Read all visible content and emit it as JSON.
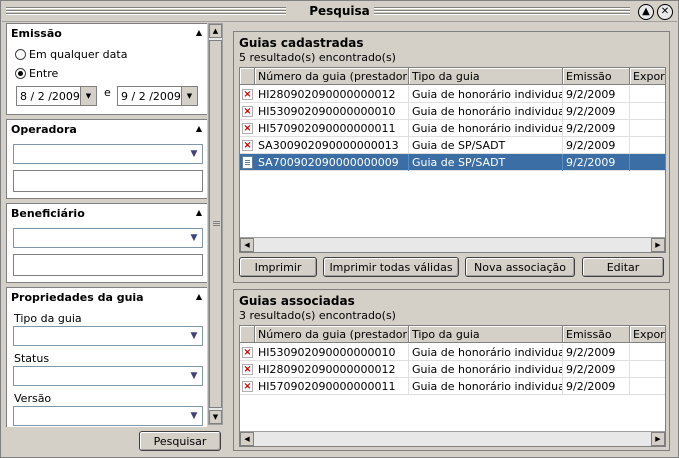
{
  "window": {
    "title": "Pesquisa"
  },
  "filters": {
    "emissao": {
      "title": "Emissão",
      "option_any": "Em qualquer data",
      "option_between": "Entre",
      "date_from": "8 / 2 /2009",
      "date_sep": "e",
      "date_to": "9 / 2 /2009"
    },
    "operadora": {
      "title": "Operadora"
    },
    "beneficiario": {
      "title": "Beneficiário"
    },
    "propriedades": {
      "title": "Propriedades da guia",
      "tipo_label": "Tipo da guia",
      "status_label": "Status",
      "versao_label": "Versão"
    },
    "search_button": "Pesquisar"
  },
  "cadastradas": {
    "title": "Guias cadastradas",
    "count": "5 resultado(s) encontrado(s)",
    "columns": [
      "Número da guia (prestador)",
      "Tipo da guia",
      "Emissão",
      "Exporta"
    ],
    "rows": [
      {
        "icon": "error",
        "numero": "HI280902090000000012",
        "tipo": "Guia de honorário individual",
        "emissao": "9/2/2009"
      },
      {
        "icon": "error",
        "numero": "HI530902090000000010",
        "tipo": "Guia de honorário individual",
        "emissao": "9/2/2009"
      },
      {
        "icon": "error",
        "numero": "HI570902090000000011",
        "tipo": "Guia de honorário individual",
        "emissao": "9/2/2009"
      },
      {
        "icon": "error",
        "numero": "SA300902090000000013",
        "tipo": "Guia de SP/SADT",
        "emissao": "9/2/2009"
      },
      {
        "icon": "document",
        "numero": "SA700902090000000009",
        "tipo": "Guia de SP/SADT",
        "emissao": "9/2/2009",
        "selected": true
      }
    ],
    "buttons": {
      "imprimir": "Imprimir",
      "imprimir_todas": "Imprimir todas válidas",
      "nova_associacao": "Nova associação",
      "editar": "Editar"
    }
  },
  "associadas": {
    "title": "Guias associadas",
    "count": "3 resultado(s) encontrado(s)",
    "columns": [
      "Número da guia (prestador)",
      "Tipo da guia",
      "Emissão",
      "Exporta"
    ],
    "rows": [
      {
        "icon": "error",
        "numero": "HI530902090000000010",
        "tipo": "Guia de honorário individual",
        "emissao": "9/2/2009"
      },
      {
        "icon": "error",
        "numero": "HI280902090000000012",
        "tipo": "Guia de honorário individual",
        "emissao": "9/2/2009"
      },
      {
        "icon": "error",
        "numero": "HI570902090000000011",
        "tipo": "Guia de honorário individual",
        "emissao": "9/2/2009"
      }
    ]
  },
  "colors": {
    "selection": "#3a6ea5",
    "error_icon": "#d00000"
  }
}
